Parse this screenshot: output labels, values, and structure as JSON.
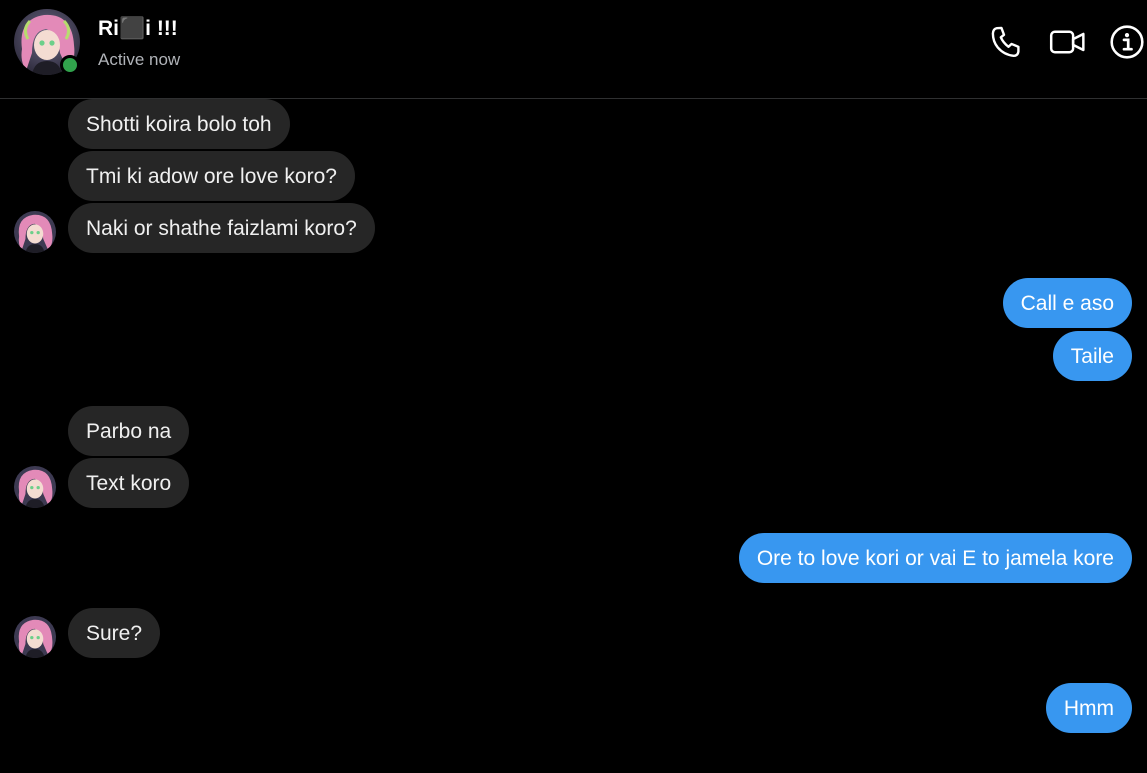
{
  "header": {
    "name": "Ri⬛i !!!",
    "status": "Active now",
    "accent": "#3897f0",
    "online_color": "#31a24c",
    "icons": [
      "phone-icon",
      "video-camera-icon",
      "info-icon"
    ]
  },
  "messages": [
    {
      "side": "in",
      "text": "Shotti koira bolo toh"
    },
    {
      "side": "in",
      "text": "Tmi ki adow ore love koro?"
    },
    {
      "side": "in",
      "text": "Naki or shathe faizlami koro?"
    },
    {
      "side": "out",
      "text": "Call e aso"
    },
    {
      "side": "out",
      "text": "Taile"
    },
    {
      "side": "in",
      "text": "Parbo na"
    },
    {
      "side": "in",
      "text": "Text koro"
    },
    {
      "side": "out",
      "text": "Ore to love kori or vai E to jamela kore"
    },
    {
      "side": "in",
      "text": "Sure?"
    },
    {
      "side": "out",
      "text": "Hmm"
    }
  ]
}
